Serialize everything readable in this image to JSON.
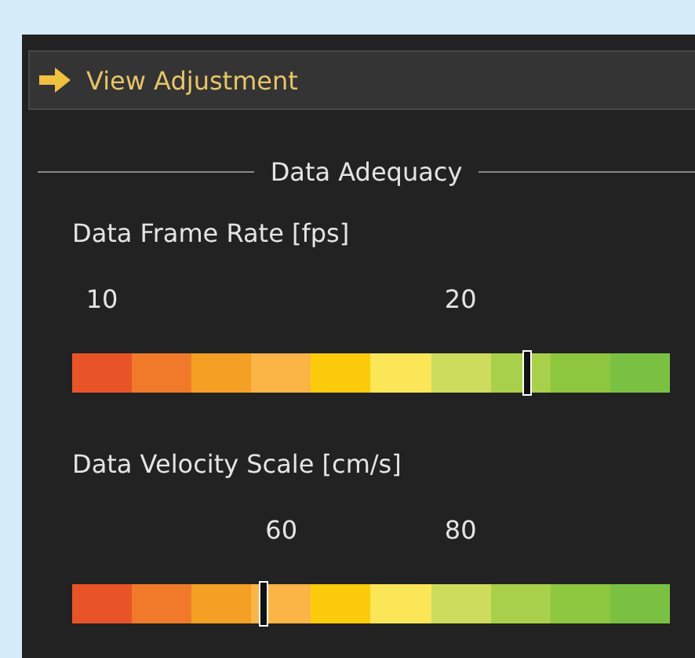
{
  "header": {
    "title": "View Adjustment"
  },
  "section": {
    "title": "Data Adequacy"
  },
  "scales": [
    {
      "label": "Data Frame Rate [fps]",
      "level": 0.76,
      "segments": [
        {
          "color": "#e85428",
          "tick": "10"
        },
        {
          "color": "#f07a2a"
        },
        {
          "color": "#f4a024"
        },
        {
          "color": "#fbb446"
        },
        {
          "color": "#fccb0c"
        },
        {
          "color": "#fbe658"
        },
        {
          "color": "#cddc5c",
          "tick": "20"
        },
        {
          "color": "#a9d04a"
        },
        {
          "color": "#8dc63f"
        },
        {
          "color": "#7ac143"
        }
      ]
    },
    {
      "label": "Data Velocity Scale [cm/s]",
      "level": 0.32,
      "segments": [
        {
          "color": "#e85428"
        },
        {
          "color": "#f07a2a"
        },
        {
          "color": "#f4a024"
        },
        {
          "color": "#fbb446",
          "tick": "60"
        },
        {
          "color": "#fccb0c"
        },
        {
          "color": "#fbe658"
        },
        {
          "color": "#cddc5c",
          "tick": "80"
        },
        {
          "color": "#a9d04a"
        },
        {
          "color": "#8dc63f"
        },
        {
          "color": "#7ac143"
        }
      ]
    }
  ]
}
